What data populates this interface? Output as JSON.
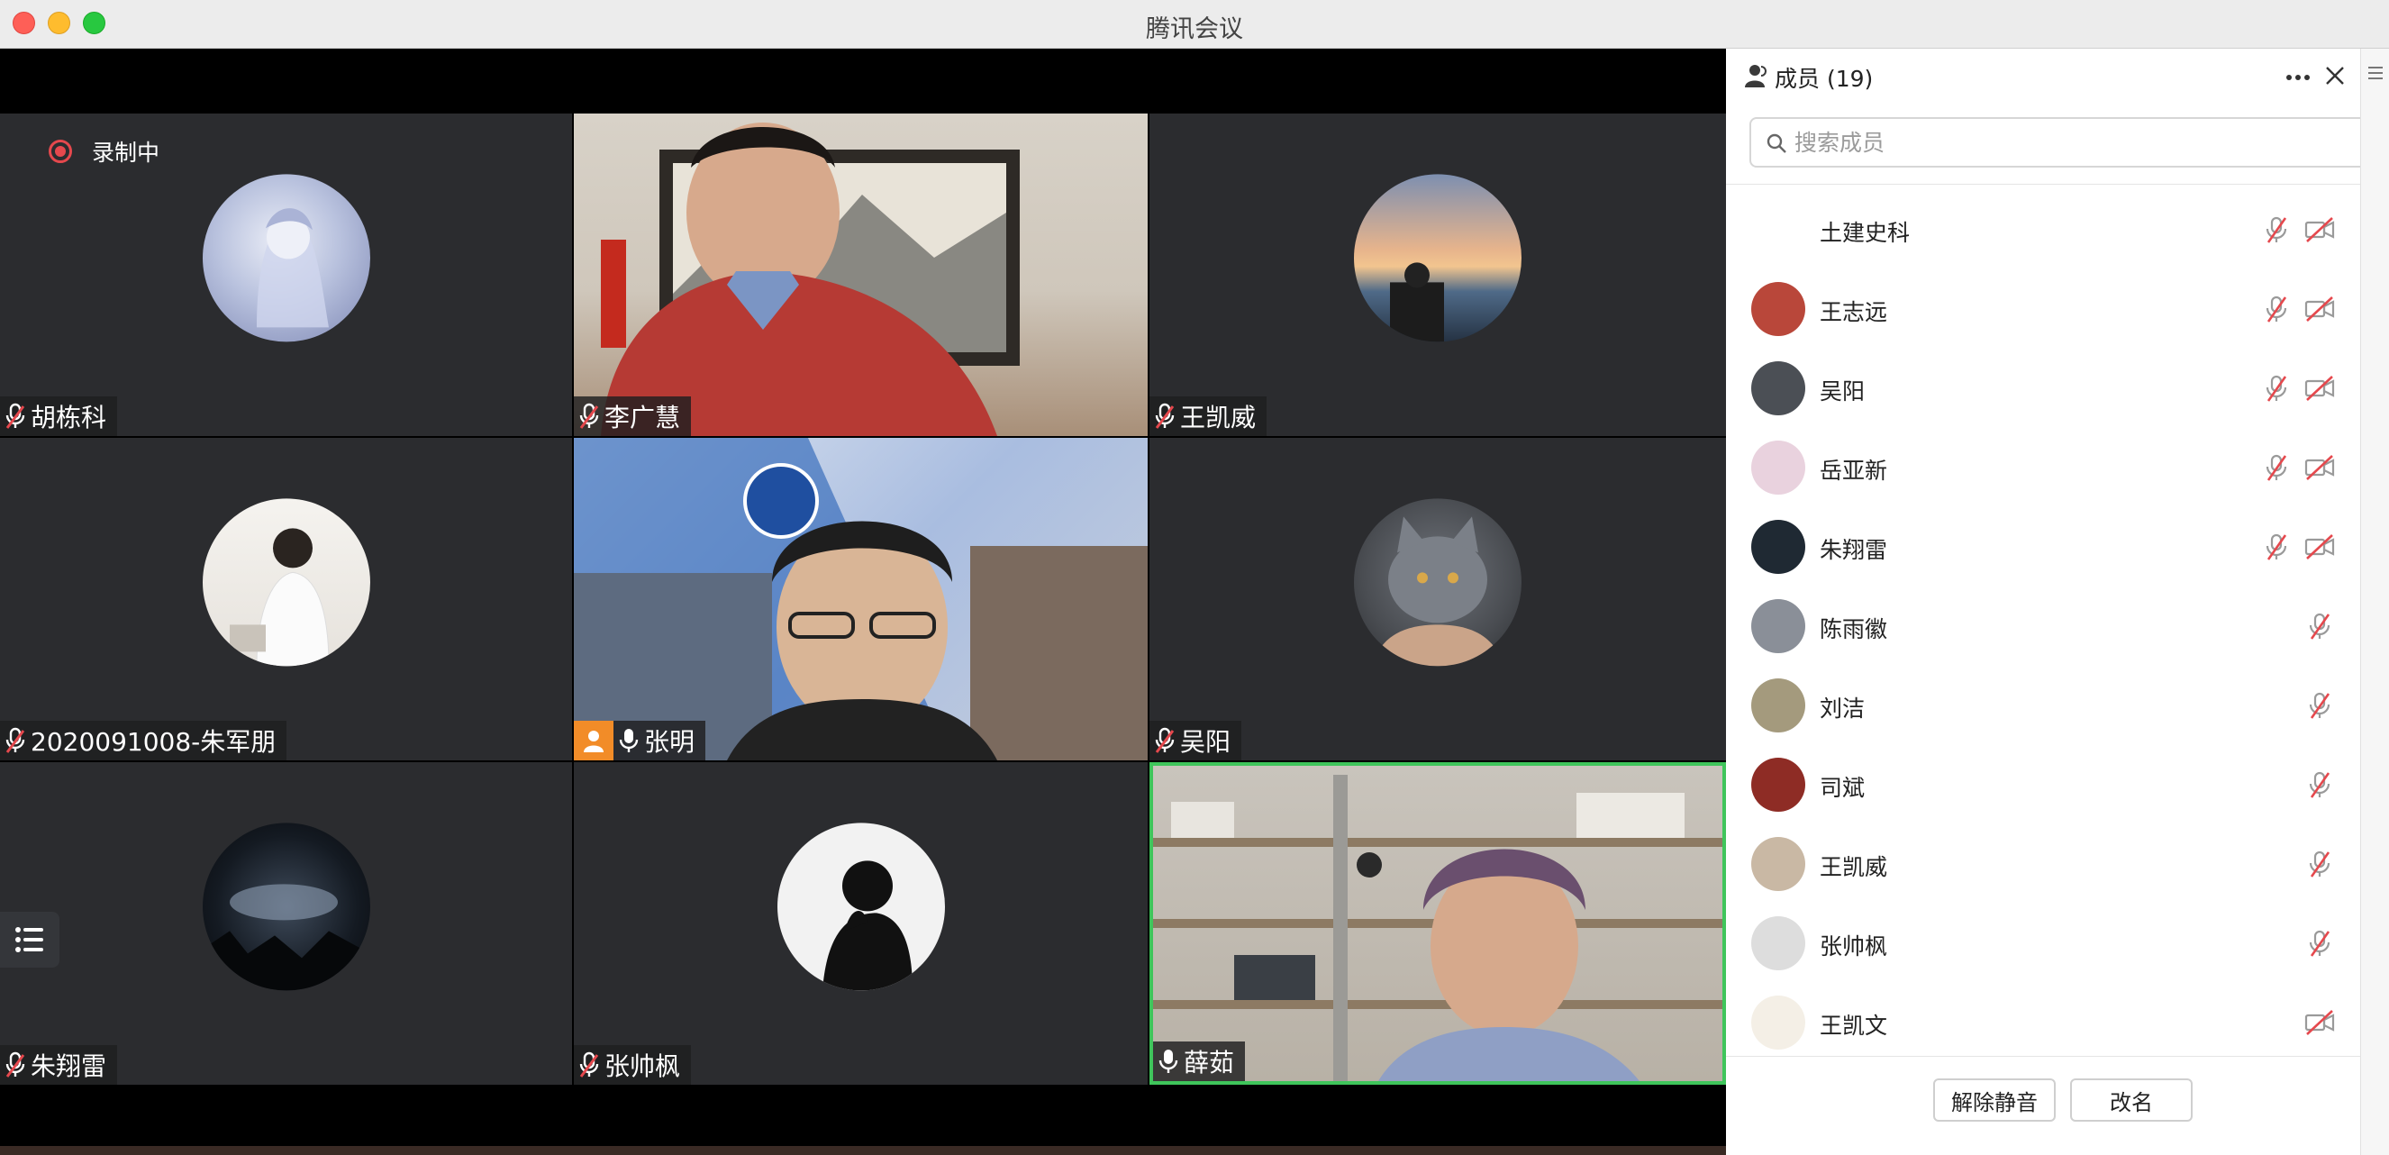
{
  "window": {
    "title": "腾讯会议"
  },
  "recording": {
    "label": "录制中"
  },
  "tiles": [
    {
      "name": "胡栋科",
      "muted": true
    },
    {
      "name": "李广慧",
      "muted": true
    },
    {
      "name": "王凯威",
      "muted": true
    },
    {
      "name": "2020091008-朱军朋",
      "muted": true
    },
    {
      "name": "张明",
      "muted": false
    },
    {
      "name": "吴阳",
      "muted": true
    },
    {
      "name": "朱翔雷",
      "muted": true
    },
    {
      "name": "张帅枫",
      "muted": true
    },
    {
      "name": "薛茹",
      "muted": false
    }
  ],
  "panel": {
    "title": "成员 (19)",
    "search_placeholder": "搜索成员",
    "members": [
      {
        "name": "土建史科",
        "mic_muted": true,
        "cam_off": true
      },
      {
        "name": "王志远",
        "mic_muted": true,
        "cam_off": true
      },
      {
        "name": "吴阳",
        "mic_muted": true,
        "cam_off": true
      },
      {
        "name": "岳亚新",
        "mic_muted": true,
        "cam_off": true
      },
      {
        "name": "朱翔雷",
        "mic_muted": true,
        "cam_off": true
      },
      {
        "name": "陈雨徽",
        "mic_muted": true,
        "cam_off": false
      },
      {
        "name": "刘洁",
        "mic_muted": true,
        "cam_off": false
      },
      {
        "name": "司斌",
        "mic_muted": true,
        "cam_off": false
      },
      {
        "name": "王凯威",
        "mic_muted": true,
        "cam_off": false
      },
      {
        "name": "张帅枫",
        "mic_muted": true,
        "cam_off": false
      },
      {
        "name": "王凯文",
        "mic_muted": false,
        "cam_off": true
      }
    ],
    "unmute_label": "解除静音",
    "rename_label": "改名"
  },
  "colors": {
    "muted_red": "#e5484d",
    "active_speaker": "#3fc55b",
    "tile_bg": "#2b2c2f"
  }
}
